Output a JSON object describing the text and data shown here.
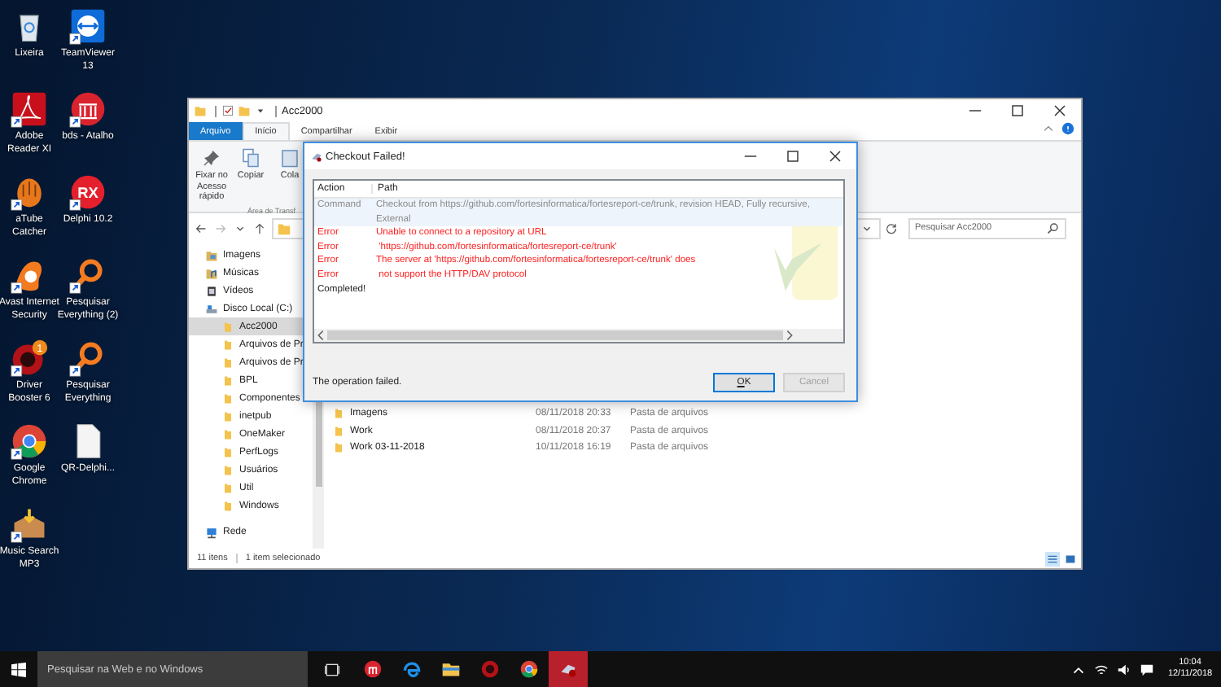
{
  "desktop": {
    "icons": [
      {
        "label": "Lixeira",
        "shortcut": false
      },
      {
        "label": "TeamViewer 13",
        "shortcut": true
      },
      {
        "label": "Adobe Reader XI",
        "shortcut": true
      },
      {
        "label": "bds - Atalho",
        "shortcut": true
      },
      {
        "label": "aTube Catcher",
        "shortcut": true
      },
      {
        "label": "Delphi 10.2",
        "shortcut": true,
        "logo_text": "RX"
      },
      {
        "label": "Avast Internet Security",
        "shortcut": true
      },
      {
        "label": "Pesquisar Everything (2)",
        "shortcut": true
      },
      {
        "label": "Driver Booster 6",
        "shortcut": true,
        "badge": "1"
      },
      {
        "label": "Pesquisar Everything",
        "shortcut": true
      },
      {
        "label": "Google Chrome",
        "shortcut": true
      },
      {
        "label": "QR-Delphi...",
        "shortcut": false
      },
      {
        "label": "Music Search MP3",
        "shortcut": true
      }
    ]
  },
  "explorer": {
    "title": "Acc2000",
    "ribbon_tabs": [
      {
        "label": "Arquivo",
        "kind": "file",
        "selected": false
      },
      {
        "label": "Início",
        "kind": "tab",
        "selected": true
      },
      {
        "label": "Compartilhar",
        "kind": "tab",
        "selected": false
      },
      {
        "label": "Exibir",
        "kind": "tab",
        "selected": false
      }
    ],
    "ribbon_commands": [
      {
        "label": "Fixar no Acesso rápido"
      },
      {
        "label": "Copiar"
      },
      {
        "label": "Cola"
      }
    ],
    "ribbon_group": "Área de Transf",
    "search": {
      "placeholder": "Pesquisar Acc2000"
    },
    "nav": [
      {
        "label": "Imagens",
        "kind": "pictures",
        "selected": false
      },
      {
        "label": "Músicas",
        "kind": "music",
        "selected": false
      },
      {
        "label": "Vídeos",
        "kind": "videos",
        "selected": false
      },
      {
        "label": "Disco Local (C:)",
        "kind": "drive",
        "selected": false,
        "children": [
          {
            "label": "Acc2000",
            "kind": "folder",
            "selected": true
          },
          {
            "label": "Arquivos de Pr",
            "kind": "folder",
            "selected": false
          },
          {
            "label": "Arquivos de Pr",
            "kind": "folder",
            "selected": false
          },
          {
            "label": "BPL",
            "kind": "folder",
            "selected": false
          },
          {
            "label": "Componentes",
            "kind": "folder",
            "selected": false
          },
          {
            "label": "inetpub",
            "kind": "folder",
            "selected": false
          },
          {
            "label": "OneMaker",
            "kind": "folder",
            "selected": false
          },
          {
            "label": "PerfLogs",
            "kind": "folder",
            "selected": false
          },
          {
            "label": "Usuários",
            "kind": "folder",
            "selected": false
          },
          {
            "label": "Util",
            "kind": "folder",
            "selected": false
          },
          {
            "label": "Windows",
            "kind": "folder",
            "selected": false
          }
        ]
      },
      {
        "label": "Rede",
        "kind": "network",
        "selected": false
      }
    ],
    "files": [
      {
        "name": "Imagens",
        "date": "08/11/2018 20:33",
        "type": "Pasta de arquivos"
      },
      {
        "name": "Work",
        "date": "08/11/2018 20:37",
        "type": "Pasta de arquivos"
      },
      {
        "name": "Work 03-11-2018",
        "date": "10/11/2018 16:19",
        "type": "Pasta de arquivos"
      }
    ],
    "status_bar": {
      "count": "11 itens",
      "selection": "1 item selecionado"
    }
  },
  "dialog": {
    "title": "Checkout Failed!",
    "columns": [
      "Action",
      "Path"
    ],
    "rows": [
      {
        "kind": "command",
        "action": "Command",
        "path": "Checkout from https://github.com/fortesinformatica/fortesreport-ce/trunk, revision HEAD, Fully recursive, External"
      },
      {
        "kind": "error",
        "action": "Error",
        "path": "Unable to connect to a repository at URL"
      },
      {
        "kind": "error",
        "action": "Error",
        "path": " 'https://github.com/fortesinformatica/fortesreport-ce/trunk'"
      },
      {
        "kind": "error",
        "action": "Error",
        "path": "The server at 'https://github.com/fortesinformatica/fortesreport-ce/trunk' does"
      },
      {
        "kind": "error",
        "action": "Error",
        "path": " not support the HTTP/DAV protocol"
      },
      {
        "kind": "info",
        "action": "Completed!",
        "path": ""
      }
    ],
    "message": "The operation failed.",
    "buttons": [
      {
        "label": "OK",
        "disabled": false
      },
      {
        "label": "Cancel",
        "disabled": true
      }
    ]
  },
  "taskbar": {
    "search": {
      "placeholder": "Pesquisar na Web e no Windows"
    },
    "apps": [
      {
        "active": false
      },
      {
        "active": false
      },
      {
        "active": false
      },
      {
        "active": false
      },
      {
        "active": false
      },
      {
        "active": true
      }
    ],
    "clock": {
      "time": "10:04",
      "date": "12/11/2018"
    }
  }
}
